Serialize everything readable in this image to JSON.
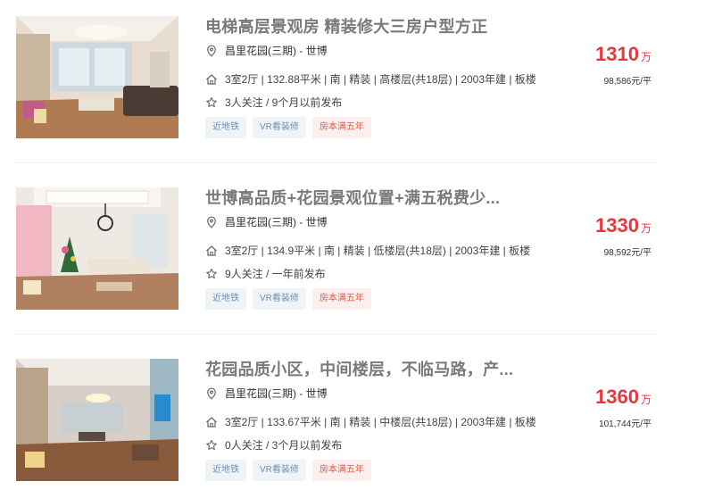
{
  "listings": [
    {
      "title": "电梯高层景观房 精装修大三房户型方正",
      "address": "昌里花园(三期) - 世博",
      "info": "3室2厅 | 132.88平米 | 南 | 精装 | 高楼层(共18层) | 2003年建 | 板楼",
      "follow": "3人关注 / 9个月以前发布",
      "tags": [
        "近地铁",
        "VR看装修",
        "房本满五年"
      ],
      "price": "1310",
      "price_unit": "万",
      "unit_price": "98,586元/平"
    },
    {
      "title": "世博高品质+花园景观位置+满五税费少...",
      "address": "昌里花园(三期) - 世博",
      "info": "3室2厅 | 134.9平米 | 南 | 精装 | 低楼层(共18层) | 2003年建 | 板楼",
      "follow": "9人关注 / 一年前发布",
      "tags": [
        "近地铁",
        "VR看装修",
        "房本满五年"
      ],
      "price": "1330",
      "price_unit": "万",
      "unit_price": "98,592元/平"
    },
    {
      "title": "花园品质小区，中间楼层，不临马路，产...",
      "address": "昌里花园(三期) - 世博",
      "info": "3室2厅 | 133.67平米 | 南 | 精装 | 中楼层(共18层) | 2003年建 | 板楼",
      "follow": "0人关注 / 3个月以前发布",
      "tags": [
        "近地铁",
        "VR看装修",
        "房本满五年"
      ],
      "price": "1360",
      "price_unit": "万",
      "unit_price": "101,744元/平"
    }
  ],
  "icons": {
    "address": "location-pin-icon",
    "info": "house-icon",
    "follow": "star-icon"
  },
  "colors": {
    "price": "#e4393c",
    "title": "#7a7a7a",
    "tag_bg": "#f0f4f8",
    "tag_text": "#6b8fb2",
    "tag_taxfree_bg": "#fdefed",
    "tag_taxfree_text": "#e65a45"
  }
}
